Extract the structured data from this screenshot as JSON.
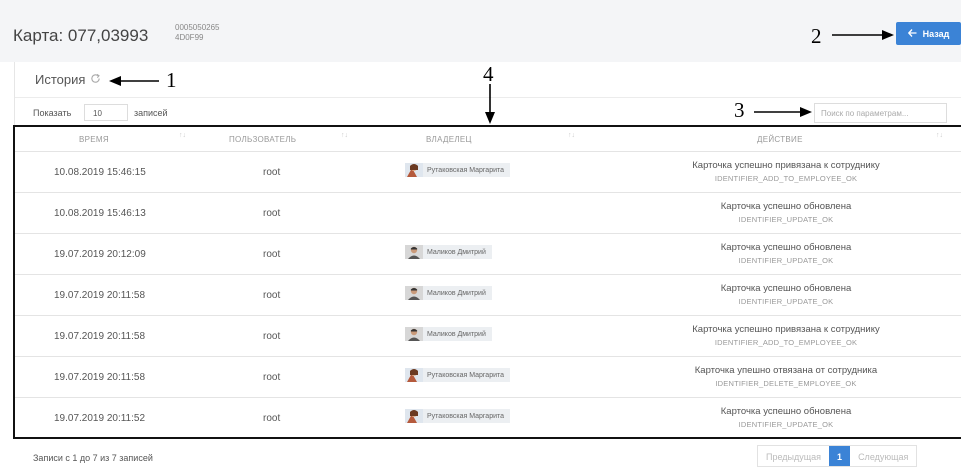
{
  "header": {
    "card_title": "Карта: 077,03993",
    "card_id_line1": "0005050265",
    "card_id_line2": "4D0F99",
    "back_label": "Назад",
    "back_icon": "arrow-left-icon"
  },
  "annotations": [
    "1",
    "2",
    "3",
    "4"
  ],
  "history": {
    "title": "История",
    "refresh_icon": "refresh-icon"
  },
  "controls": {
    "show_label": "Показать",
    "page_size": "10",
    "records_label": "записей",
    "search_placeholder": "Поиск по параметрам..."
  },
  "table": {
    "columns": [
      "ВРЕМЯ",
      "ПОЛЬЗОВАТЕЛЬ",
      "ВЛАДЕЛЕЦ",
      "ДЕЙСТВИЕ"
    ],
    "rows": [
      {
        "time": "10.08.2019 15:46:15",
        "user": "root",
        "owner": "Рутаковская Маргарита",
        "avatar": "avatar-female",
        "action": "Карточка успешно привязана к сотруднику",
        "code": "IDENTIFIER_ADD_TO_EMPLOYEE_OK"
      },
      {
        "time": "10.08.2019 15:46:13",
        "user": "root",
        "owner": "",
        "avatar": "",
        "action": "Карточка успешно обновлена",
        "code": "IDENTIFIER_UPDATE_OK"
      },
      {
        "time": "19.07.2019 20:12:09",
        "user": "root",
        "owner": "Маликов Дмитрий",
        "avatar": "avatar-male",
        "action": "Карточка успешно обновлена",
        "code": "IDENTIFIER_UPDATE_OK"
      },
      {
        "time": "19.07.2019 20:11:58",
        "user": "root",
        "owner": "Маликов Дмитрий",
        "avatar": "avatar-male",
        "action": "Карточка успешно обновлена",
        "code": "IDENTIFIER_UPDATE_OK"
      },
      {
        "time": "19.07.2019 20:11:58",
        "user": "root",
        "owner": "Маликов Дмитрий",
        "avatar": "avatar-male",
        "action": "Карточка успешно привязана к сотруднику",
        "code": "IDENTIFIER_ADD_TO_EMPLOYEE_OK"
      },
      {
        "time": "19.07.2019 20:11:58",
        "user": "root",
        "owner": "Рутаковская Маргарита",
        "avatar": "avatar-female",
        "action": "Карточка упешно отвязана от сотрудника",
        "code": "IDENTIFIER_DELETE_EMPLOYEE_OK"
      },
      {
        "time": "19.07.2019 20:11:52",
        "user": "root",
        "owner": "Рутаковская Маргарита",
        "avatar": "avatar-female",
        "action": "Карточка успешно обновлена",
        "code": "IDENTIFIER_UPDATE_OK"
      }
    ]
  },
  "footer": {
    "info": "Записи с 1 до 7 из 7 записей",
    "prev": "Предыдущая",
    "current_page": "1",
    "next": "Следующая"
  },
  "colors": {
    "accent": "#3b83d6",
    "annotation": "#000000"
  }
}
